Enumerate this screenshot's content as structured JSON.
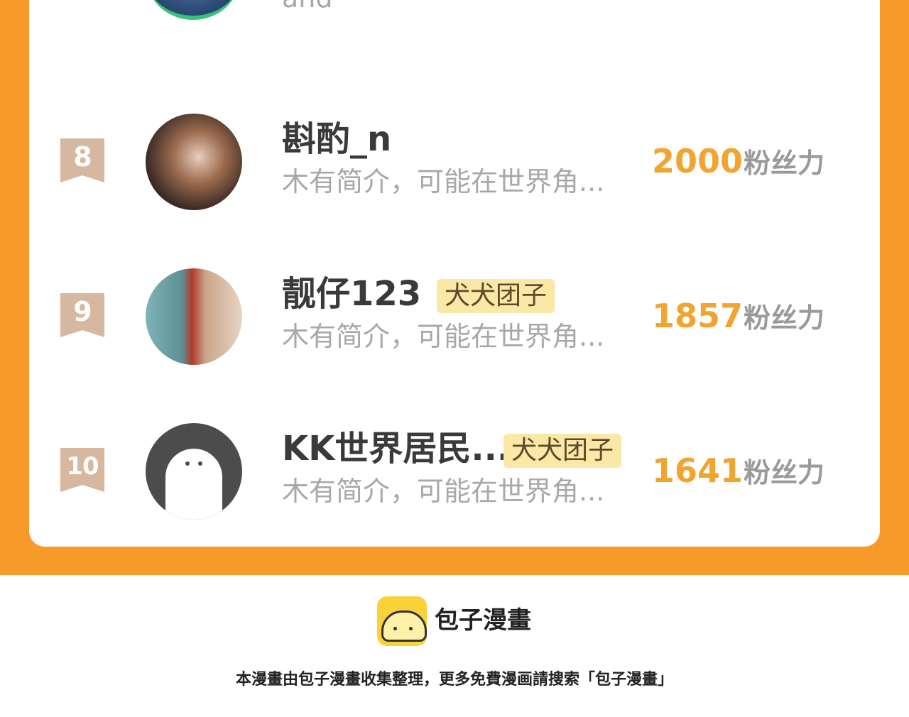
{
  "partial": {
    "desc": "and 一 ·"
  },
  "rows": [
    {
      "rank": "8",
      "name": "斟酌_n",
      "badge": "",
      "desc": "木有简介，可能在世界角...",
      "count": "2000",
      "unit": "粉丝力"
    },
    {
      "rank": "9",
      "name": "靓仔123",
      "badge": "犬犬团子",
      "desc": "木有简介，可能在世界角...",
      "count": "1857",
      "unit": "粉丝力"
    },
    {
      "rank": "10",
      "name": "KK世界居民...",
      "badge": "犬犬团子",
      "desc": "木有简介，可能在世界角...",
      "count": "1641",
      "unit": "粉丝力"
    }
  ],
  "footer": {
    "brand": "包子漫畫",
    "notice": "本漫畫由包子漫畫收集整理，更多免費漫画請搜索「包子漫畫」"
  },
  "colors": {
    "accent": "#f89a2a",
    "count": "#f2a431",
    "badge_bg": "#fbe8a6",
    "rank_bg": "#d6b8a0"
  }
}
